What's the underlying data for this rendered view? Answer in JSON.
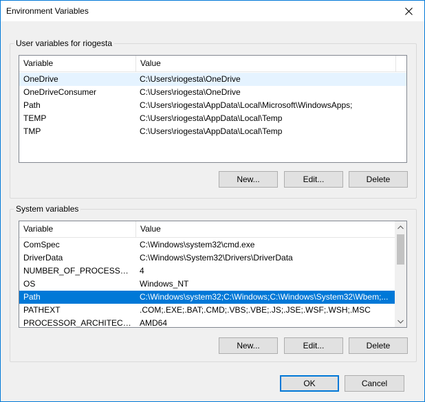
{
  "window": {
    "title": "Environment Variables"
  },
  "user_vars": {
    "group_label": "User variables for riogesta",
    "columns": [
      "Variable",
      "Value"
    ],
    "rows": [
      {
        "variable": "OneDrive",
        "value": "C:\\Users\\riogesta\\OneDrive"
      },
      {
        "variable": "OneDriveConsumer",
        "value": "C:\\Users\\riogesta\\OneDrive"
      },
      {
        "variable": "Path",
        "value": "C:\\Users\\riogesta\\AppData\\Local\\Microsoft\\WindowsApps;"
      },
      {
        "variable": "TEMP",
        "value": "C:\\Users\\riogesta\\AppData\\Local\\Temp"
      },
      {
        "variable": "TMP",
        "value": "C:\\Users\\riogesta\\AppData\\Local\\Temp"
      }
    ],
    "buttons": {
      "new": "New...",
      "edit": "Edit...",
      "delete": "Delete"
    }
  },
  "system_vars": {
    "group_label": "System variables",
    "columns": [
      "Variable",
      "Value"
    ],
    "rows": [
      {
        "variable": "ComSpec",
        "value": "C:\\Windows\\system32\\cmd.exe"
      },
      {
        "variable": "DriverData",
        "value": "C:\\Windows\\System32\\Drivers\\DriverData"
      },
      {
        "variable": "NUMBER_OF_PROCESSORS",
        "value": "4"
      },
      {
        "variable": "OS",
        "value": "Windows_NT"
      },
      {
        "variable": "Path",
        "value": "C:\\Windows\\system32;C:\\Windows;C:\\Windows\\System32\\Wbem;..."
      },
      {
        "variable": "PATHEXT",
        "value": ".COM;.EXE;.BAT;.CMD;.VBS;.VBE;.JS;.JSE;.WSF;.WSH;.MSC"
      },
      {
        "variable": "PROCESSOR_ARCHITECTURE",
        "value": "AMD64"
      }
    ],
    "buttons": {
      "new": "New...",
      "edit": "Edit...",
      "delete": "Delete"
    }
  },
  "footer": {
    "ok": "OK",
    "cancel": "Cancel"
  },
  "colors": {
    "accent": "#0078d7",
    "selection": "#0078d7",
    "hover": "#e5f3ff"
  }
}
